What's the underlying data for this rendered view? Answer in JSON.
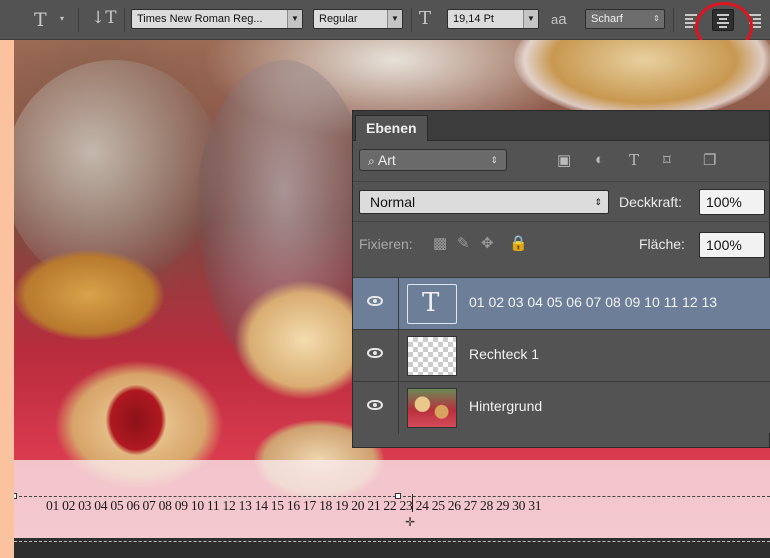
{
  "options_bar": {
    "font_family": "Times New Roman Reg...",
    "font_style": "Regular",
    "font_size": "19,14 Pt",
    "aa_glyph": "a",
    "aa_sub": "a",
    "antialias": "Scharf",
    "icons": [
      "type-tool-icon",
      "orientation-icon",
      "font-size-icon",
      "antialias-icon",
      "align-left-icon",
      "align-center-icon",
      "align-right-icon"
    ],
    "active_alignment": "center",
    "highlight_color": "#e0141e"
  },
  "layers_panel": {
    "tab_label": "Ebenen",
    "filter_kind": "Art",
    "blend_mode": "Normal",
    "opacity_label": "Deckkraft:",
    "opacity_value": "100%",
    "lock_label": "Fixieren:",
    "fill_label": "Fläche:",
    "fill_value": "100%",
    "layers": [
      {
        "name": "01 02 03 04 05 06 07 08 09 10 11 12 13",
        "kind": "text",
        "thumb_glyph": "T",
        "selected": true,
        "visible": true
      },
      {
        "name": "Rechteck 1",
        "kind": "shape",
        "selected": false,
        "visible": true
      },
      {
        "name": "Hintergrund",
        "kind": "image",
        "selected": false,
        "visible": true
      }
    ]
  },
  "canvas": {
    "text_layer_content": "01 02 03 04 05 06 07 08 09 10 11 12 13 14 15 16 17 18 19 20 21 22 23 24 25 26 27 28 29 30 31"
  }
}
